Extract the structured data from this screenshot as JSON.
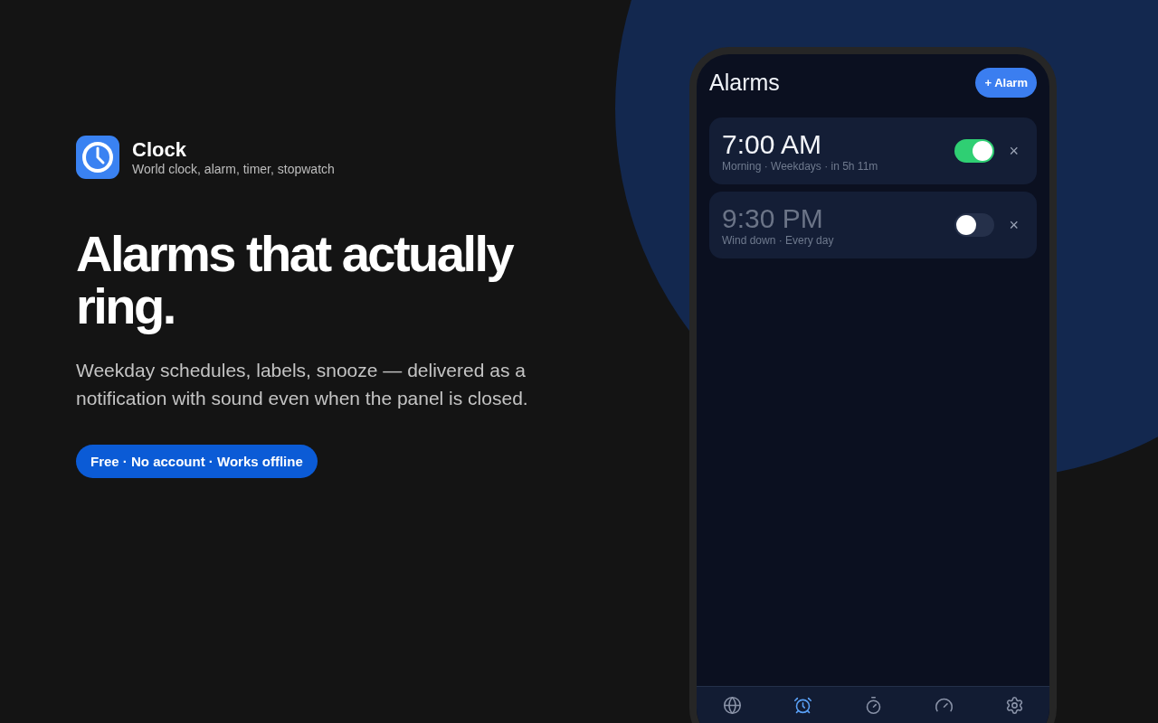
{
  "app": {
    "name": "Clock",
    "tagline": "World clock, alarm, timer, stopwatch"
  },
  "headline": "Alarms that actually ring.",
  "description": "Weekday schedules, labels, snooze — delivered as a notification with sound even when the panel is closed.",
  "pill": "Free · No account · Works offline",
  "phone": {
    "title": "Alarms",
    "add_button": "+ Alarm",
    "alarms": [
      {
        "time": "7:00 AM",
        "details": "Morning · Weekdays · in 5h 11m",
        "on": true,
        "delete": "×"
      },
      {
        "time": "9:30 PM",
        "details": "Wind down · Every day",
        "on": false,
        "delete": "×"
      }
    ],
    "tabs": [
      {
        "selected": false
      },
      {
        "selected": true
      },
      {
        "selected": false
      },
      {
        "selected": false
      },
      {
        "selected": false
      }
    ]
  }
}
